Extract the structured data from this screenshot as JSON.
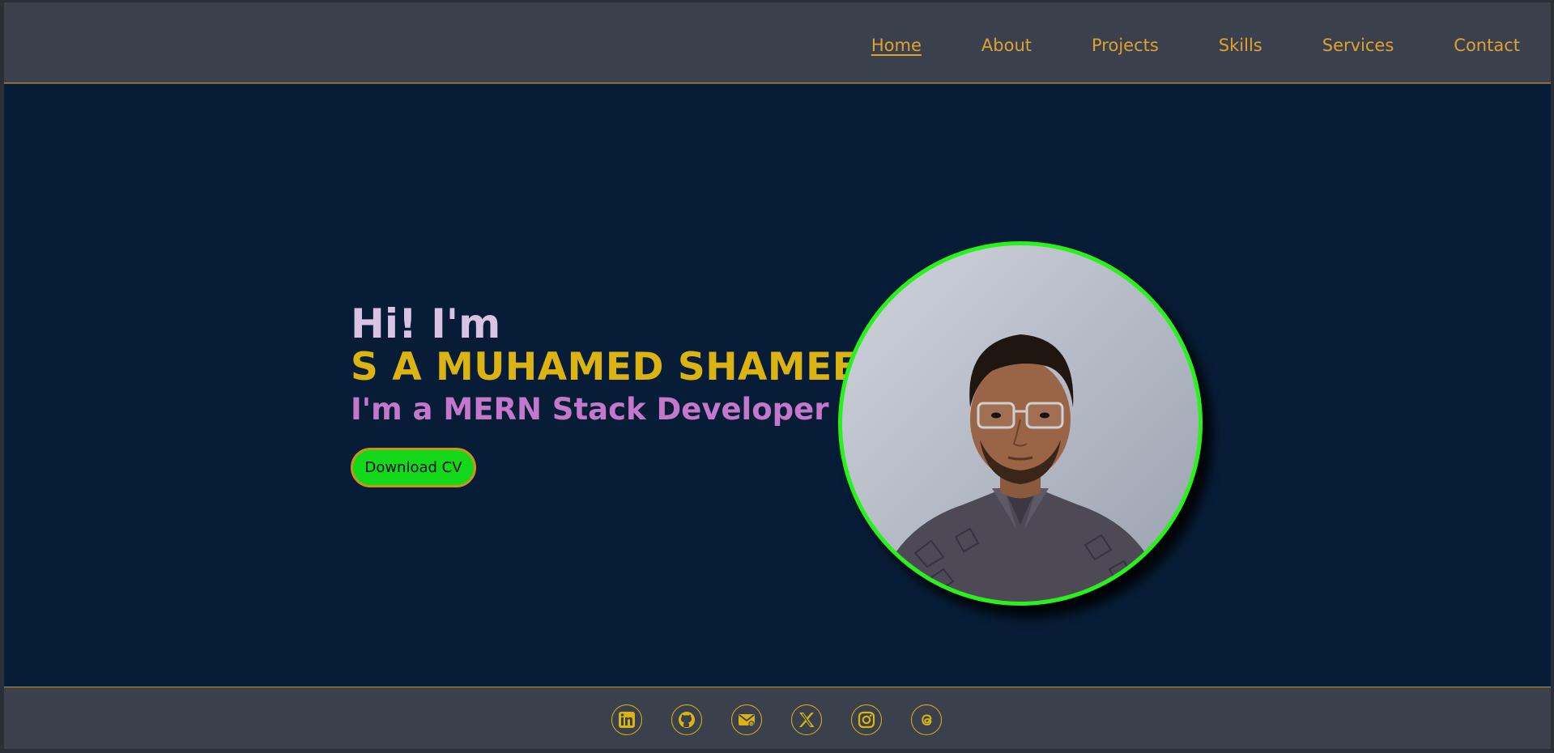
{
  "nav": {
    "items": [
      {
        "label": "Home",
        "active": true
      },
      {
        "label": "About"
      },
      {
        "label": "Projects"
      },
      {
        "label": "Skills"
      },
      {
        "label": "Services"
      },
      {
        "label": "Contact"
      }
    ]
  },
  "hero": {
    "greeting": "Hi! I'm",
    "name": "S A MUHAMED SHAMEEM",
    "role": "I'm a MERN Stack Developer",
    "cv_button": "Download CV"
  },
  "footer": {
    "socials": [
      "linkedin-icon",
      "github-icon",
      "mail-icon",
      "x-icon",
      "instagram-icon",
      "threads-icon"
    ]
  },
  "colors": {
    "accent": "#dbb414",
    "nav_link": "#e0a132",
    "hero_bg": "#071d37",
    "bar_bg": "#3a404c",
    "button": "#14d91a",
    "avatar_ring": "#27f21a",
    "role": "#c478c9"
  }
}
